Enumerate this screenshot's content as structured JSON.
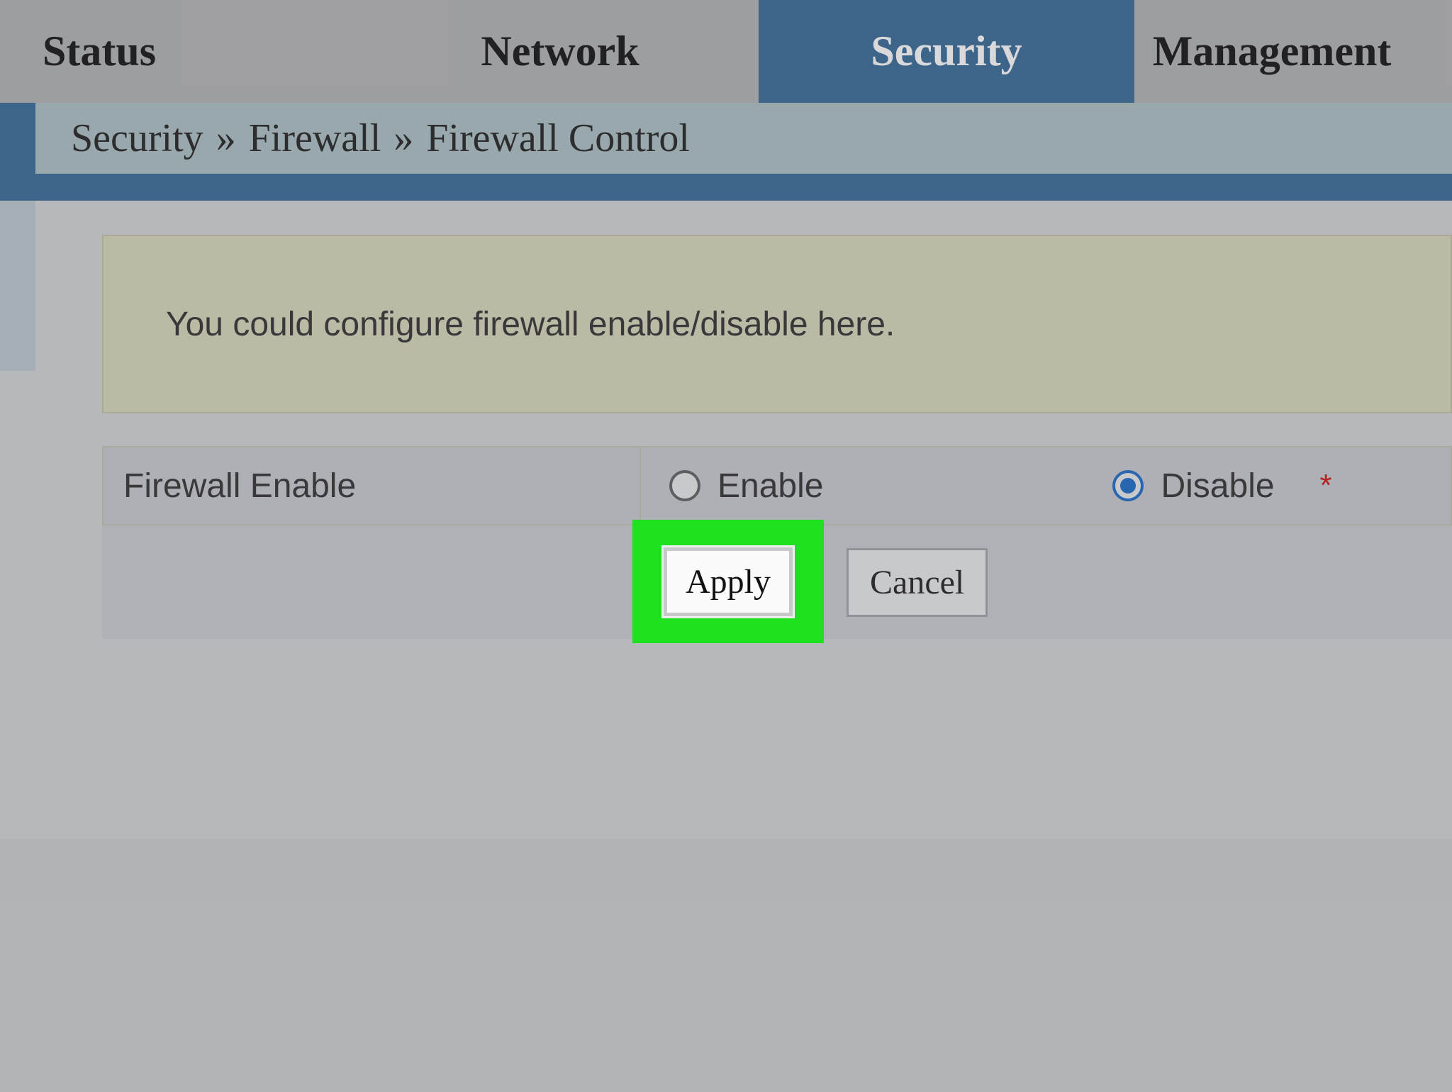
{
  "tabs": {
    "status": "Status",
    "network": "Network",
    "security": "Security",
    "management": "Management"
  },
  "breadcrumb": {
    "a": "Security",
    "b": "Firewall",
    "c": "Firewall Control",
    "sep": "»"
  },
  "info": {
    "text": "You could configure firewall enable/disable here."
  },
  "form": {
    "label": "Firewall Enable",
    "option_enable": "Enable",
    "option_disable": "Disable",
    "asterisk": "*"
  },
  "buttons": {
    "apply": "Apply",
    "cancel": "Cancel"
  }
}
